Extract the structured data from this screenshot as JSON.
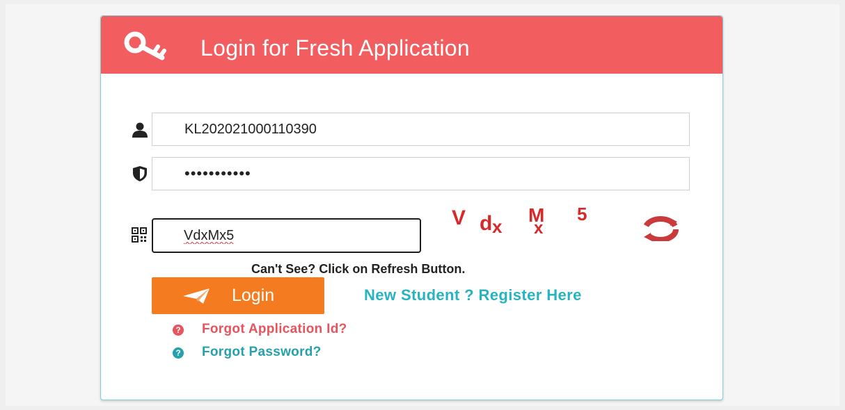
{
  "header": {
    "title": "Login for Fresh Application",
    "icon": "key-icon",
    "color": "#f25d5f"
  },
  "form": {
    "application_id": {
      "value": "KL202021000110390",
      "icon": "user-icon"
    },
    "password": {
      "value": "•••••••••••",
      "icon": "shield-icon"
    },
    "captcha_input": {
      "value": "VdxMx5",
      "icon": "qr-code-icon"
    },
    "captcha": {
      "chars": [
        "V",
        "d",
        "x",
        "M",
        "x",
        "5"
      ],
      "color": "#d8282a"
    },
    "refresh_icon": "refresh-icon",
    "hint": "Can't See? Click on Refresh Button."
  },
  "actions": {
    "login_label": "Login",
    "login_color": "#f47b20",
    "register_label": "New Student ? Register Here",
    "register_color": "#27b3c0"
  },
  "links": {
    "forgot_application_id": {
      "label": "Forgot Application Id?",
      "color": "#e8545c",
      "icon": "question-circle-icon"
    },
    "forgot_password": {
      "label": "Forgot Password?",
      "color": "#27a0ad",
      "icon": "question-circle-icon"
    }
  }
}
